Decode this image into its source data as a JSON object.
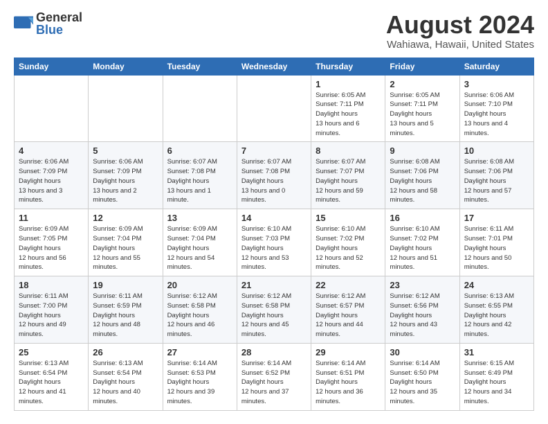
{
  "header": {
    "logo_general": "General",
    "logo_blue": "Blue",
    "title": "August 2024",
    "subtitle": "Wahiawa, Hawaii, United States"
  },
  "days_of_week": [
    "Sunday",
    "Monday",
    "Tuesday",
    "Wednesday",
    "Thursday",
    "Friday",
    "Saturday"
  ],
  "weeks": [
    [
      {
        "day": "",
        "info": ""
      },
      {
        "day": "",
        "info": ""
      },
      {
        "day": "",
        "info": ""
      },
      {
        "day": "",
        "info": ""
      },
      {
        "day": "1",
        "sunrise": "6:05 AM",
        "sunset": "7:11 PM",
        "daylight": "13 hours and 6 minutes."
      },
      {
        "day": "2",
        "sunrise": "6:05 AM",
        "sunset": "7:11 PM",
        "daylight": "13 hours and 5 minutes."
      },
      {
        "day": "3",
        "sunrise": "6:06 AM",
        "sunset": "7:10 PM",
        "daylight": "13 hours and 4 minutes."
      }
    ],
    [
      {
        "day": "4",
        "sunrise": "6:06 AM",
        "sunset": "7:09 PM",
        "daylight": "13 hours and 3 minutes."
      },
      {
        "day": "5",
        "sunrise": "6:06 AM",
        "sunset": "7:09 PM",
        "daylight": "13 hours and 2 minutes."
      },
      {
        "day": "6",
        "sunrise": "6:07 AM",
        "sunset": "7:08 PM",
        "daylight": "13 hours and 1 minute."
      },
      {
        "day": "7",
        "sunrise": "6:07 AM",
        "sunset": "7:08 PM",
        "daylight": "13 hours and 0 minutes."
      },
      {
        "day": "8",
        "sunrise": "6:07 AM",
        "sunset": "7:07 PM",
        "daylight": "12 hours and 59 minutes."
      },
      {
        "day": "9",
        "sunrise": "6:08 AM",
        "sunset": "7:06 PM",
        "daylight": "12 hours and 58 minutes."
      },
      {
        "day": "10",
        "sunrise": "6:08 AM",
        "sunset": "7:06 PM",
        "daylight": "12 hours and 57 minutes."
      }
    ],
    [
      {
        "day": "11",
        "sunrise": "6:09 AM",
        "sunset": "7:05 PM",
        "daylight": "12 hours and 56 minutes."
      },
      {
        "day": "12",
        "sunrise": "6:09 AM",
        "sunset": "7:04 PM",
        "daylight": "12 hours and 55 minutes."
      },
      {
        "day": "13",
        "sunrise": "6:09 AM",
        "sunset": "7:04 PM",
        "daylight": "12 hours and 54 minutes."
      },
      {
        "day": "14",
        "sunrise": "6:10 AM",
        "sunset": "7:03 PM",
        "daylight": "12 hours and 53 minutes."
      },
      {
        "day": "15",
        "sunrise": "6:10 AM",
        "sunset": "7:02 PM",
        "daylight": "12 hours and 52 minutes."
      },
      {
        "day": "16",
        "sunrise": "6:10 AM",
        "sunset": "7:02 PM",
        "daylight": "12 hours and 51 minutes."
      },
      {
        "day": "17",
        "sunrise": "6:11 AM",
        "sunset": "7:01 PM",
        "daylight": "12 hours and 50 minutes."
      }
    ],
    [
      {
        "day": "18",
        "sunrise": "6:11 AM",
        "sunset": "7:00 PM",
        "daylight": "12 hours and 49 minutes."
      },
      {
        "day": "19",
        "sunrise": "6:11 AM",
        "sunset": "6:59 PM",
        "daylight": "12 hours and 48 minutes."
      },
      {
        "day": "20",
        "sunrise": "6:12 AM",
        "sunset": "6:58 PM",
        "daylight": "12 hours and 46 minutes."
      },
      {
        "day": "21",
        "sunrise": "6:12 AM",
        "sunset": "6:58 PM",
        "daylight": "12 hours and 45 minutes."
      },
      {
        "day": "22",
        "sunrise": "6:12 AM",
        "sunset": "6:57 PM",
        "daylight": "12 hours and 44 minutes."
      },
      {
        "day": "23",
        "sunrise": "6:12 AM",
        "sunset": "6:56 PM",
        "daylight": "12 hours and 43 minutes."
      },
      {
        "day": "24",
        "sunrise": "6:13 AM",
        "sunset": "6:55 PM",
        "daylight": "12 hours and 42 minutes."
      }
    ],
    [
      {
        "day": "25",
        "sunrise": "6:13 AM",
        "sunset": "6:54 PM",
        "daylight": "12 hours and 41 minutes."
      },
      {
        "day": "26",
        "sunrise": "6:13 AM",
        "sunset": "6:54 PM",
        "daylight": "12 hours and 40 minutes."
      },
      {
        "day": "27",
        "sunrise": "6:14 AM",
        "sunset": "6:53 PM",
        "daylight": "12 hours and 39 minutes."
      },
      {
        "day": "28",
        "sunrise": "6:14 AM",
        "sunset": "6:52 PM",
        "daylight": "12 hours and 37 minutes."
      },
      {
        "day": "29",
        "sunrise": "6:14 AM",
        "sunset": "6:51 PM",
        "daylight": "12 hours and 36 minutes."
      },
      {
        "day": "30",
        "sunrise": "6:14 AM",
        "sunset": "6:50 PM",
        "daylight": "12 hours and 35 minutes."
      },
      {
        "day": "31",
        "sunrise": "6:15 AM",
        "sunset": "6:49 PM",
        "daylight": "12 hours and 34 minutes."
      }
    ]
  ],
  "labels": {
    "sunrise": "Sunrise:",
    "sunset": "Sunset:",
    "daylight": "Daylight hours"
  }
}
